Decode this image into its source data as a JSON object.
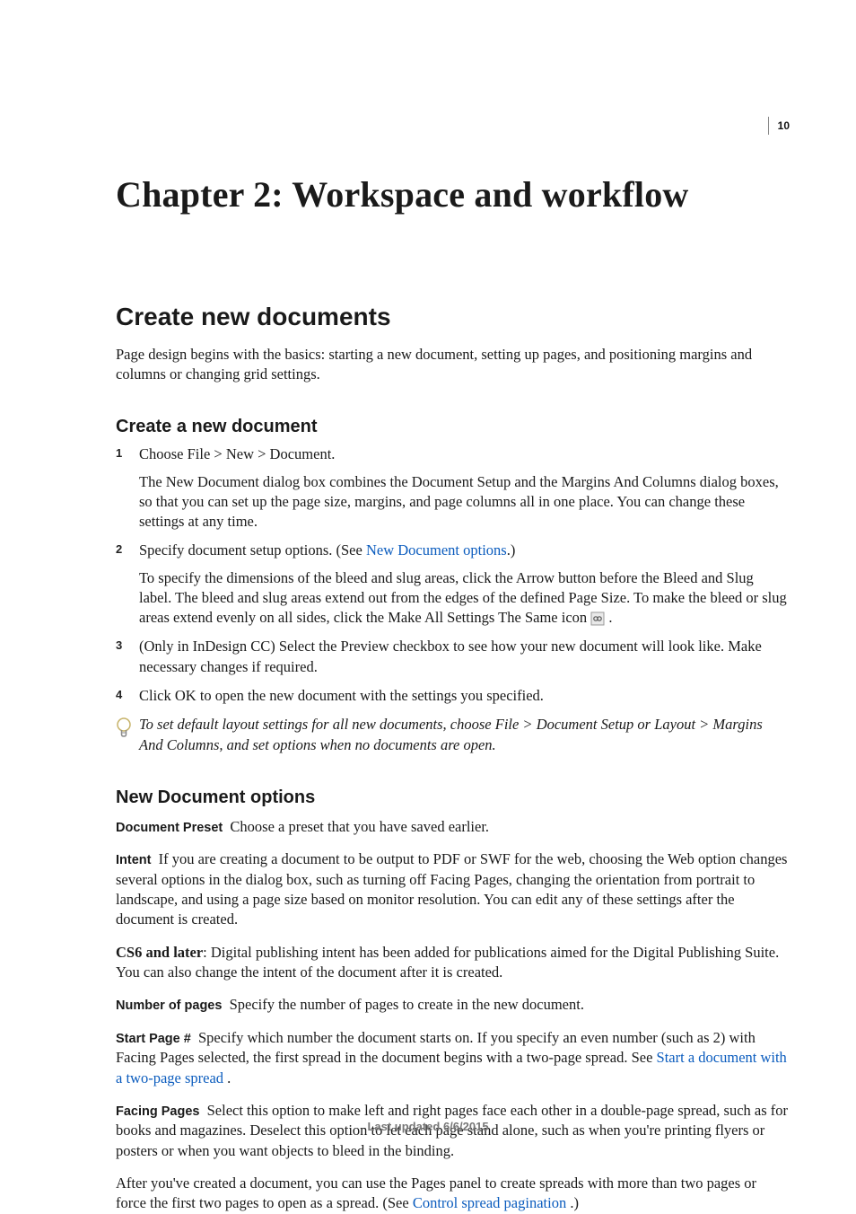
{
  "page_number": "10",
  "chapter_title": "Chapter 2: Workspace and workflow",
  "section_title": "Create new documents",
  "intro": "Page design begins with the basics: starting a new document, setting up pages, and positioning margins and columns or changing grid settings.",
  "sub1": {
    "heading": "Create a new document",
    "step1": "Choose File > New > Document.",
    "step1_desc": "The New Document dialog box combines the Document Setup and the Margins And Columns dialog boxes, so that you can set up the page size, margins, and page columns all in one place. You can change these settings at any time.",
    "step2_pre": "Specify document setup options. (See ",
    "step2_link": "New Document options",
    "step2_post": ".)",
    "step2_desc": "To specify the dimensions of the bleed and slug areas, click the Arrow button before the Bleed and Slug label. The bleed and slug areas extend out from the edges of the defined Page Size. To make the bleed or slug areas extend evenly on all sides, click the Make All Settings The Same icon ",
    "step2_after_icon": " .",
    "step3": "(Only in InDesign CC) Select the Preview checkbox to see how your new document will look like. Make necessary changes if required.",
    "step4": "Click OK to open the new document with the settings you specified.",
    "tip": "To set default layout settings for all new documents, choose File > Document Setup or Layout > Margins And Columns, and set options when no documents are open."
  },
  "sub2": {
    "heading": "New Document options",
    "doc_preset_term": "Document Preset",
    "doc_preset": "Choose a preset that you have saved earlier.",
    "intent_term": "Intent",
    "intent": "If you are creating a document to be output to PDF or SWF for the web, choosing the Web option changes several options in the dialog box, such as turning off Facing Pages, changing the orientation from portrait to landscape, and using a page size based on monitor resolution. You can edit any of these settings after the document is created.",
    "cs6_bold": "CS6 and later",
    "cs6_rest": ": Digital publishing intent has been added for publications aimed for the Digital Publishing Suite. You can also change the intent of the document after it is created.",
    "num_pages_term": "Number of pages",
    "num_pages": "Specify the number of pages to create in the new document.",
    "start_page_term": "Start Page #",
    "start_page_pre": "Specify which number the document starts on. If you specify an even number (such as 2) with Facing Pages selected, the first spread in the document begins with a two-page spread. See ",
    "start_page_link": "Start a document with a two-page spread",
    "start_page_post": " .",
    "facing_term": "Facing Pages",
    "facing": "Select this option to make left and right pages face each other in a double-page spread, such as for books and magazines. Deselect this option to let each page stand alone, such as when you're printing flyers or posters or when you want objects to bleed in the binding.",
    "after_facing_pre": "After you've created a document, you can use the Pages panel to create spreads with more than two pages or force the first two pages to open as a spread. (See ",
    "after_facing_link": "Control spread pagination",
    "after_facing_post": " .)"
  },
  "footer": "Last updated 6/6/2015"
}
